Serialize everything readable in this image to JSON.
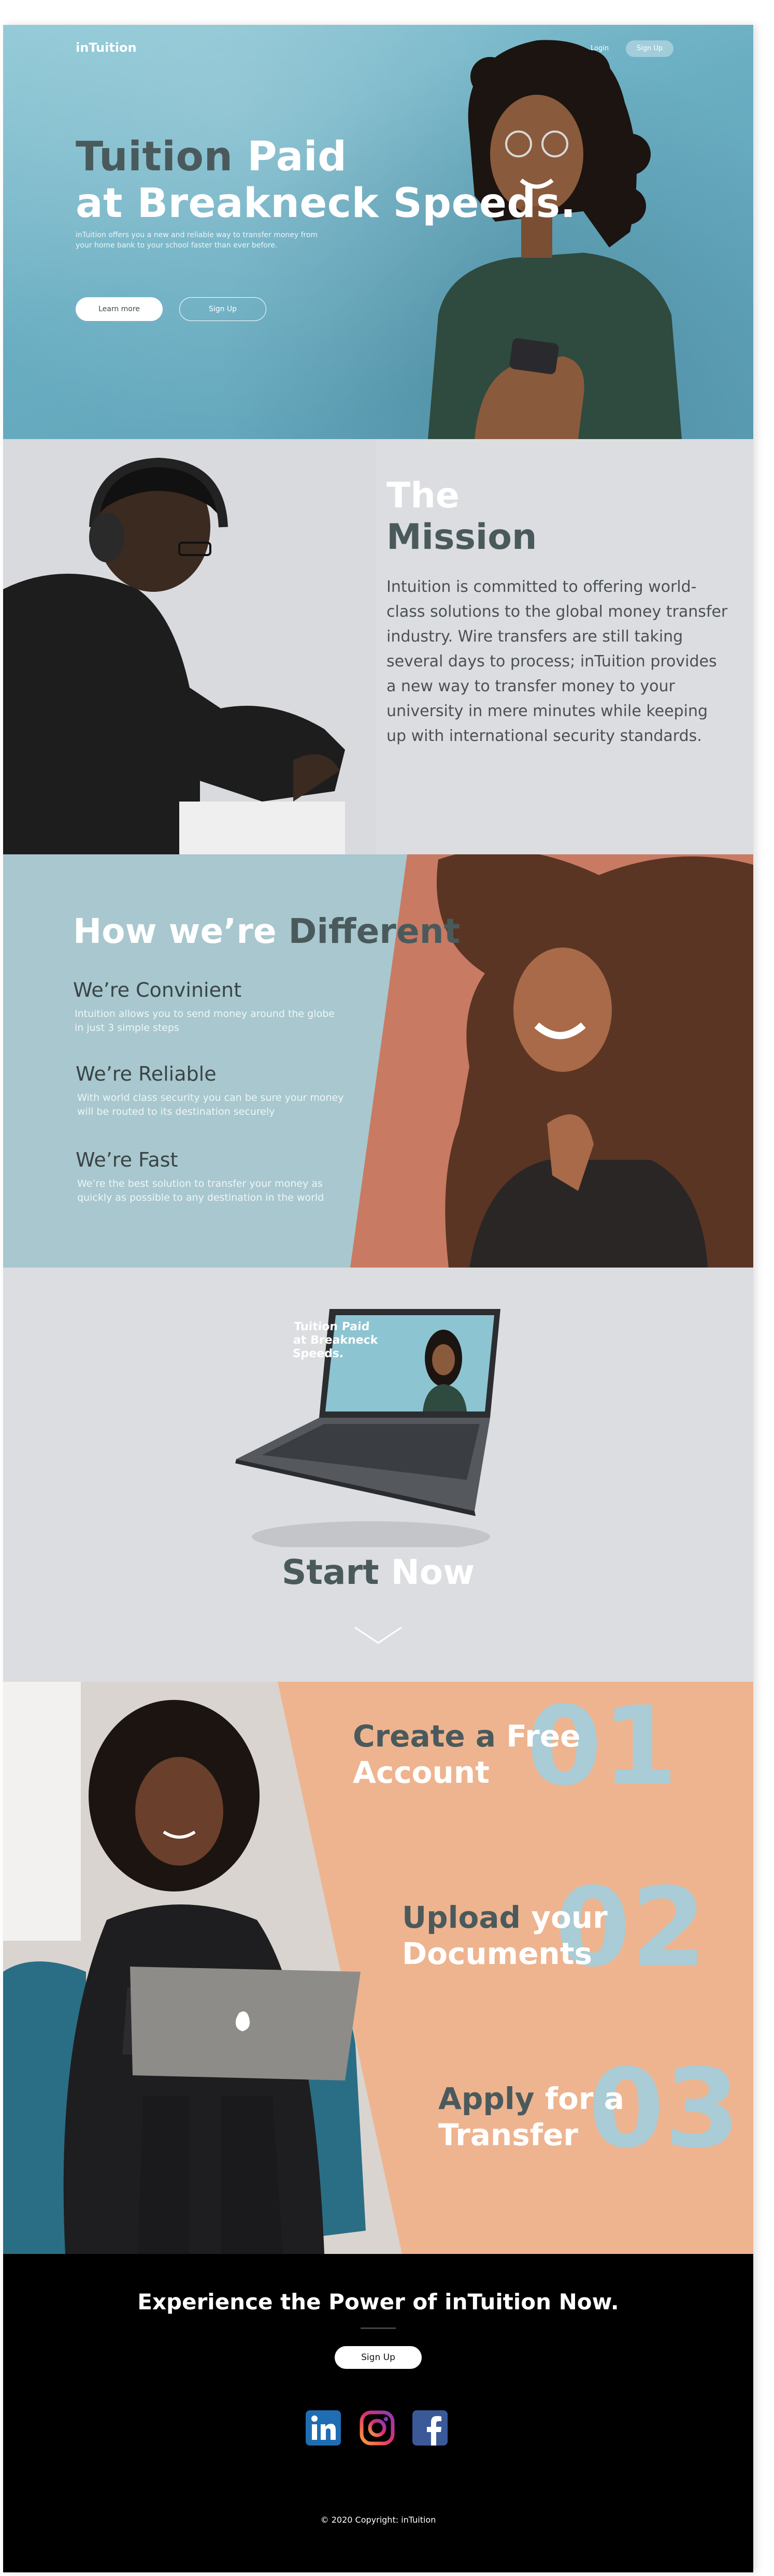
{
  "nav": {
    "logo": "inTuition",
    "login": "Login",
    "signup": "Sign Up"
  },
  "hero": {
    "title_line1_a": "Tuition ",
    "title_line1_b": "Paid",
    "title_line2": "at Breakneck Speeds.",
    "description": "inTuition offers you a new and reliable way to transfer money from your home bank to your school faster than ever before.",
    "learn_more": "Learn more",
    "signup": "Sign Up"
  },
  "mission": {
    "title_line1": "The",
    "title_line2": "Mission",
    "text": "Intuition is committed to offering world-class solutions to the global money transfer industry. Wire transfers are still taking several days to process; inTuition provides a new way to transfer money to your university in mere minutes while keeping up with international security standards."
  },
  "different": {
    "title_a": "How we’re ",
    "title_b": "Different",
    "features": [
      {
        "heading": "We’re Convinient",
        "text": "Intuition allows you to send money around the globe in just 3 simple steps"
      },
      {
        "heading": "We’re Reliable",
        "text": "With world class security you can be sure your money will be routed to its destination securely"
      },
      {
        "heading": "We’re Fast",
        "text": "We’re the best solution to transfer your money as quickly as possible to any destination in the world"
      }
    ]
  },
  "laptop_screen": {
    "title_line1": "Tuition Paid",
    "title_line2": "at Breakneck Speeds."
  },
  "start_now": {
    "a": "Start ",
    "b": "Now"
  },
  "steps": [
    {
      "number": "01",
      "line1_a": "Create a ",
      "line1_b": "Free",
      "line2": "Account"
    },
    {
      "number": "02",
      "line1_a": "Upload ",
      "line1_b": "your",
      "line2": "Documents"
    },
    {
      "number": "03",
      "line1_a": "Apply ",
      "line1_b": "for a",
      "line2": "Transfer"
    }
  ],
  "footer": {
    "cta": "Experience the Power of inTuition Now.",
    "signup": "Sign Up",
    "copyright": "© 2020 Copyright: inTuition"
  },
  "colors": {
    "teal": "#8fc8d6",
    "slate": "#4a5a5c",
    "peach": "#eeb48f",
    "grey": "#dcdde0"
  },
  "icons": [
    "linkedin-icon",
    "instagram-icon",
    "facebook-icon"
  ]
}
